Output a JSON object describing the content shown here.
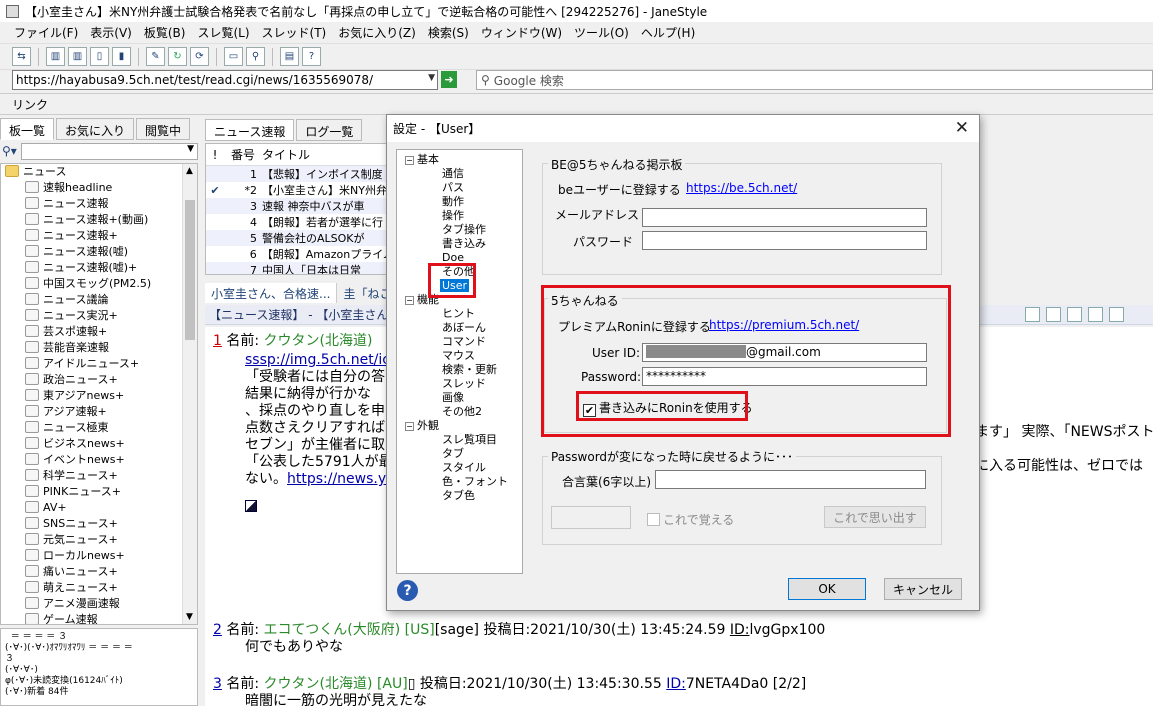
{
  "window": {
    "title": "【小室圭さん】米NY州弁護士試験合格発表で名前なし「再採点の申し立て」で逆転合格の可能性へ [294225276] - JaneStyle"
  },
  "menu": [
    "ファイル(F)",
    "表示(V)",
    "板覧(B)",
    "スレ覧(L)",
    "スレッド(T)",
    "お気に入り(Z)",
    "検索(S)",
    "ウィンドウ(W)",
    "ツール(O)",
    "ヘルプ(H)"
  ],
  "address": {
    "url": "https://hayabusa9.5ch.net/test/read.cgi/news/1635569078/",
    "search_placeholder": "Google 検索"
  },
  "linkbar": {
    "label": "リンク"
  },
  "left_tabs": [
    "板一覧",
    "お気に入り",
    "閲覧中"
  ],
  "board_tree": {
    "root": "ニュース",
    "items": [
      "速報headline",
      "ニュース速報",
      "ニュース速報+(動画)",
      "ニュース速報+",
      "ニュース速報(嘘)",
      "ニュース速報(嘘)+",
      "中国スモッグ(PM2.5)",
      "ニュース議論",
      "ニュース実況+",
      "芸スポ速報+",
      "芸能音楽速報",
      "アイドルニュース+",
      "政治ニュース+",
      "東アジアnews+",
      "アジア速報+",
      "ニュース極東",
      "ビジネスnews+",
      "イベントnews+",
      "科学ニュース+",
      "PINKニュース+",
      "AV+",
      "SNSニュース+",
      "元気ニュース+",
      "ローカルnews+",
      "痛いニュース+",
      "萌えニュース+",
      "アニメ漫画速報",
      "ゲーム速報"
    ]
  },
  "aa_panel": "  ＝ ＝ ＝ ＝ ３\n(･∀･)(･∀･)ｵﾏﾜﾘｵﾏﾜﾘ ＝ ＝ ＝ ＝\n３\n(･∀･∀･)\nφ(･∀･)未読変換(16124ﾊﾞｲﾄ)\n(･∀･)新着 84件",
  "thread_tabs": [
    "ニュース速報",
    "ログ一覧"
  ],
  "thread_list": {
    "headers": [
      "!",
      "番号",
      "タイトル"
    ],
    "rows": [
      {
        "mark": "",
        "num": "1",
        "title": "【悲報】インボイス制度"
      },
      {
        "mark": "✔",
        "num": "*2",
        "title": "【小室圭さん】米NY州弁"
      },
      {
        "mark": "",
        "num": "3",
        "title": "速報 神奈中バスが車"
      },
      {
        "mark": "",
        "num": "4",
        "title": "【朗報】若者が選挙に行"
      },
      {
        "mark": "",
        "num": "5",
        "title": "警備会社のALSOKが"
      },
      {
        "mark": "",
        "num": "6",
        "title": "【朗報】Amazonプライム"
      },
      {
        "mark": "",
        "num": "7",
        "title": "中国人「日本は日常"
      }
    ]
  },
  "read_tabs": [
    "小室圭さん、合格速...",
    "圭「ねこか"
  ],
  "read_title": "【ニュース速報】 - 【小室圭さん】米NY",
  "posts": {
    "p1": {
      "num": "1",
      "label": "名前:",
      "name": "クウタン(北海道)",
      "link": "sssp://img.5ch.net/ic",
      "lines": [
        "「受験者には自分の答",
        "結果に納得が行かな",
        "、採点のやり直しを申",
        "点数さえクリアすれば",
        "セブン」が主催者に取",
        "「公表した5791人が最"
      ],
      "tail_pre": "ない。",
      "tail_link": "https://news.ya",
      "right1": "ます」 実際、「NEWSポスト",
      "right2": "に入る可能性は、ゼロでは"
    },
    "p2": {
      "num": "2",
      "label": "名前:",
      "name": "エコてつくん(大阪府)",
      "tag": "[US]",
      "meta": "[sage] 投稿日:2021/10/30(土) 13:45:24.59",
      "id_label": "ID:",
      "id": "lvgGpx100",
      "body": "何でもありやな"
    },
    "p3": {
      "num": "3",
      "label": "名前:",
      "name": "クウタン(北海道)",
      "tag": "[AU]",
      "meta": "▯ 投稿日:2021/10/30(土) 13:45:30.55",
      "id_label": "ID:",
      "id": "7NETA4Da0 [2/2]",
      "body": "暗闇に一筋の光明が見えたな"
    }
  },
  "dialog": {
    "title": "設定 - 【User】",
    "tree": {
      "basic": "基本",
      "basic_items": [
        "通信",
        "パス",
        "動作",
        "操作",
        "タブ操作",
        "書き込み",
        "Doe",
        "その他",
        "User"
      ],
      "feature": "機能",
      "feature_items": [
        "ヒント",
        "あぼーん",
        "コマンド",
        "マウス",
        "検索・更新",
        "スレッド",
        "画像",
        "その他2"
      ],
      "appearance": "外観",
      "appearance_items": [
        "スレ覧項目",
        "タブ",
        "スタイル",
        "色・フォント",
        "タブ色"
      ]
    },
    "be": {
      "group": "BE@5ちゃんねる掲示板",
      "register_label": "beユーザーに登録する",
      "register_link": "https://be.5ch.net/",
      "mail_label": "メールアドレス",
      "mail_value": "",
      "pass_label": "パスワード",
      "pass_value": ""
    },
    "ch5": {
      "group": "5ちゃんねる",
      "register_label": "プレミアムRoninに登録する",
      "register_link": "https://premium.5ch.net/",
      "userid_label": "User ID:",
      "userid_suffix": "@gmail.com",
      "password_label": "Password:",
      "password_value": "**********",
      "check_label": "書き込みにRoninを使用する",
      "check_mark": "✔"
    },
    "recover": {
      "group": "Passwordが変になった時に戻せるように･･･",
      "phrase_label": "合言葉(6字以上)",
      "phrase_value": "",
      "remember_label": "これで覚える",
      "recall_label": "これで思い出す"
    },
    "ok": "OK",
    "cancel": "キャンセル",
    "help_glyph": "?",
    "close_glyph": "✕"
  },
  "colors": {
    "highlight": "#e0101a",
    "selection": "#0078d7",
    "link": "#0000ff"
  }
}
